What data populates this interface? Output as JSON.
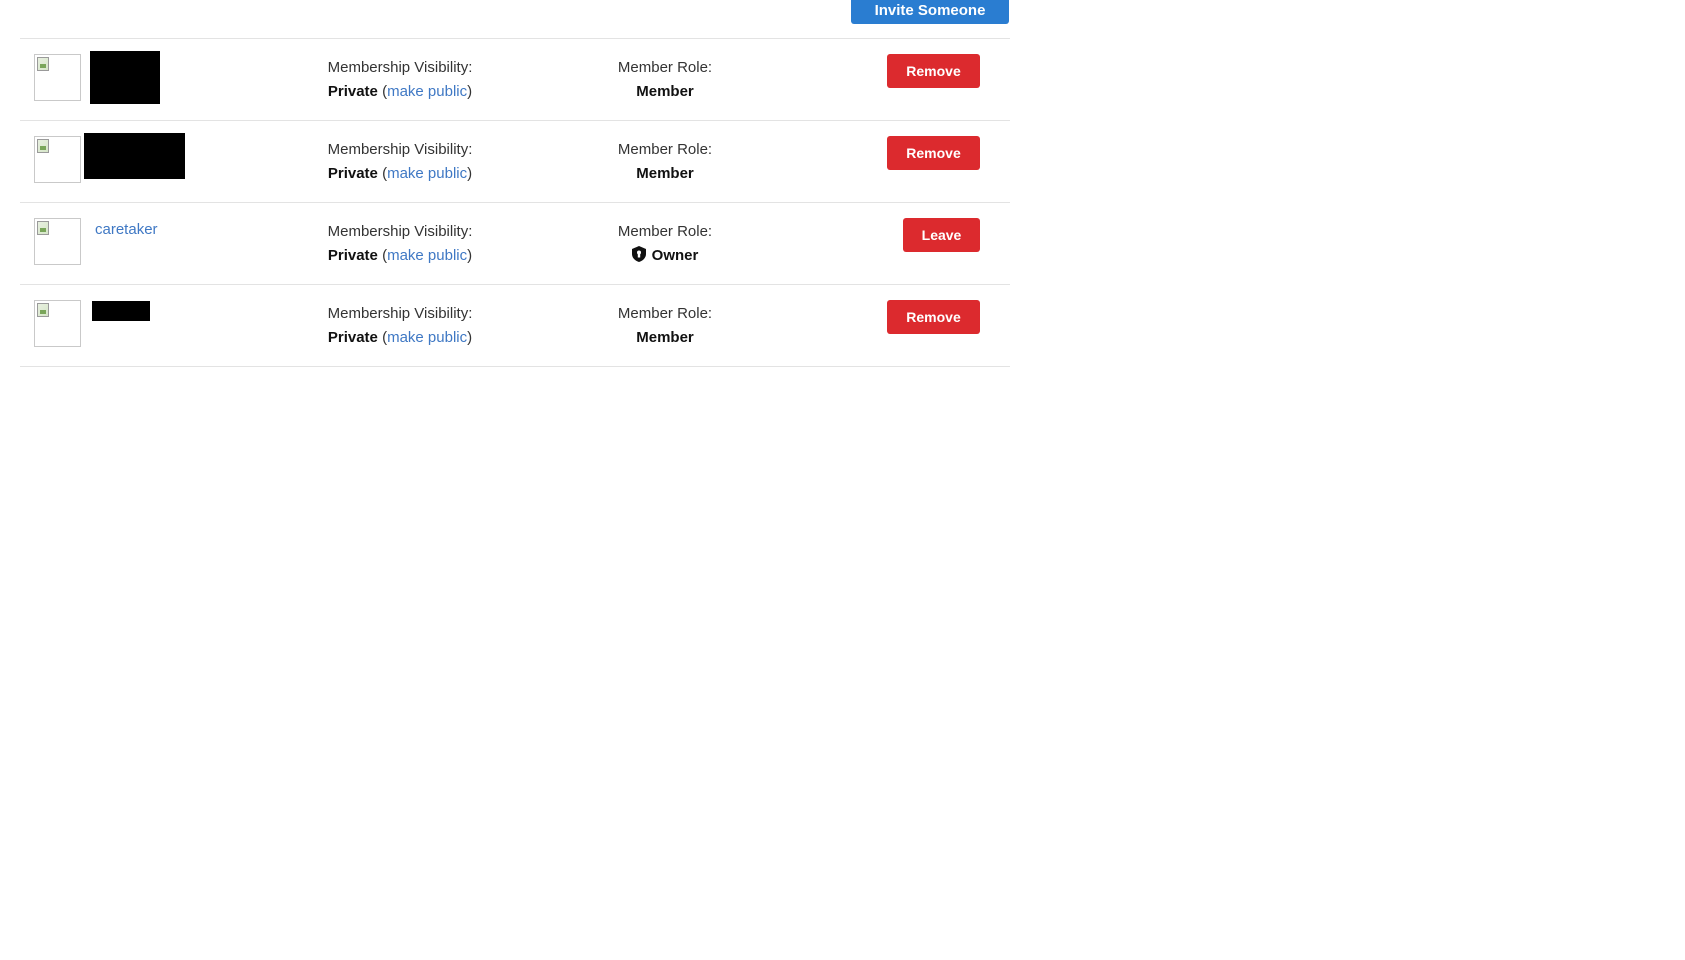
{
  "toolbar": {
    "invite_label": "Invite Someone"
  },
  "labels": {
    "visibility_label": "Membership Visibility:",
    "role_label": "Member Role:",
    "make_public": "make public"
  },
  "members": [
    {
      "name": "",
      "name_redacted": true,
      "visibility": "Private",
      "role": "Member",
      "action": "Remove"
    },
    {
      "name": "",
      "name_redacted": true,
      "visibility": "Private",
      "role": "Member",
      "action": "Remove"
    },
    {
      "name": "caretaker",
      "name_redacted": false,
      "visibility": "Private",
      "role": "Owner",
      "role_icon": "shield-icon",
      "action": "Leave"
    },
    {
      "name": "",
      "name_redacted": true,
      "visibility": "Private",
      "role": "Member",
      "action": "Remove"
    }
  ],
  "colors": {
    "primary": "#2a7dd1",
    "danger": "#dc2a2e",
    "link": "#3f78c4"
  }
}
